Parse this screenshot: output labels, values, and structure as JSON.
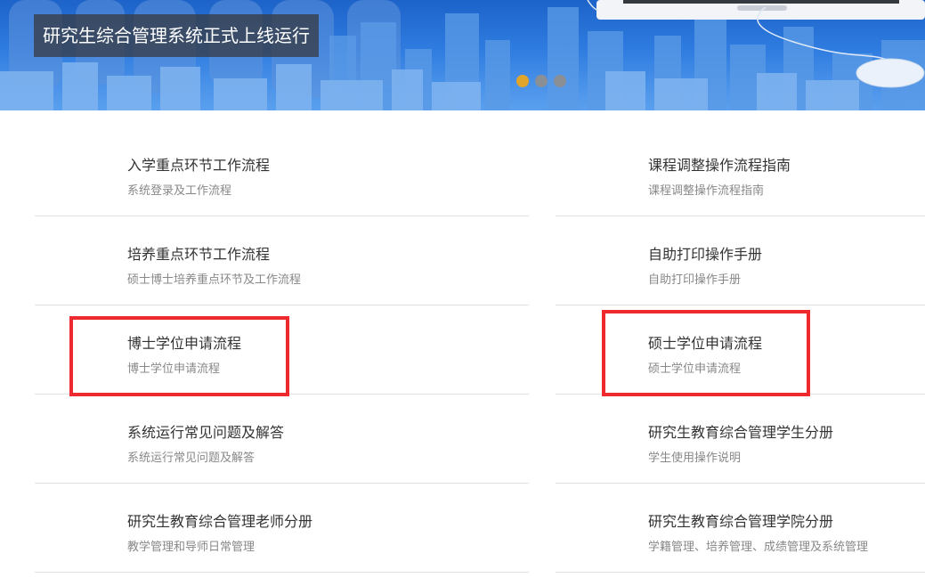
{
  "banner": {
    "caption": "研究生综合管理系统正式上线运行",
    "slide_count": 3,
    "active_slide": 1,
    "colors": {
      "dot_active": "#e0a52a",
      "dot_inactive": "#8a8f96"
    }
  },
  "left_list": [
    {
      "title": "入学重点环节工作流程",
      "subtitle": "系统登录及工作流程",
      "highlighted": false
    },
    {
      "title": "培养重点环节工作流程",
      "subtitle": "硕士博士培养重点环节及工作流程",
      "highlighted": false
    },
    {
      "title": "博士学位申请流程",
      "subtitle": "博士学位申请流程",
      "highlighted": true
    },
    {
      "title": "系统运行常见问题及解答",
      "subtitle": "系统运行常见问题及解答",
      "highlighted": false
    },
    {
      "title": "研究生教育综合管理老师分册",
      "subtitle": "教学管理和导师日常管理",
      "highlighted": false
    }
  ],
  "right_list": [
    {
      "title": "课程调整操作流程指南",
      "subtitle": "课程调整操作流程指南",
      "highlighted": false
    },
    {
      "title": "自助打印操作手册",
      "subtitle": "自助打印操作手册",
      "highlighted": false
    },
    {
      "title": "硕士学位申请流程",
      "subtitle": "硕士学位申请流程",
      "highlighted": true
    },
    {
      "title": "研究生教育综合管理学生分册",
      "subtitle": "学生使用操作说明",
      "highlighted": false
    },
    {
      "title": "研究生教育综合管理学院分册",
      "subtitle": "学籍管理、培养管理、成绩管理及系统管理",
      "highlighted": false
    }
  ],
  "colors": {
    "highlight_border": "#ee2a2f"
  }
}
